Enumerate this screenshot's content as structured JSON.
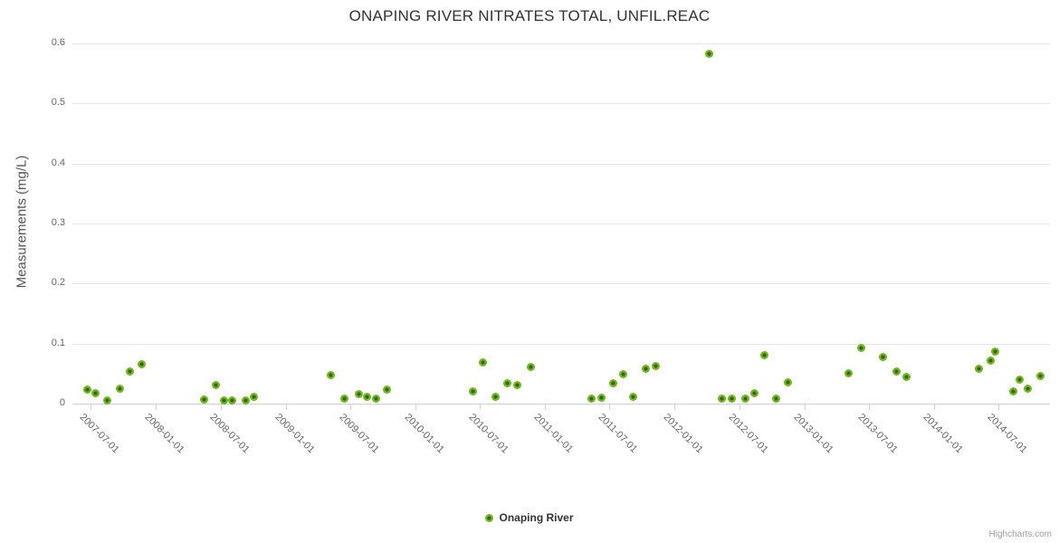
{
  "credits": "Highcharts.com",
  "colors": {
    "grid": "#e6e6e6",
    "axis_line": "#ccd1dd",
    "title_text": "#333333",
    "axis_text": "#666666",
    "legend_text": "#333333",
    "credits_text": "#9a9fa8",
    "marker_outer": "#72b71e",
    "marker_inner": "#2e6600"
  },
  "chart_data": {
    "type": "scatter",
    "title": "ONAPING RIVER NITRATES TOTAL, UNFIL.REAC",
    "xlabel": "",
    "ylabel": "Measurements (mg/L)",
    "ylim": [
      0,
      0.6
    ],
    "xlim": [
      "2007-05-11",
      "2014-11-23"
    ],
    "grid": "horizontal",
    "legend_position": "bottom-center",
    "y_tick_values": [
      0,
      0.1,
      0.2,
      0.3,
      0.4,
      0.5,
      0.6
    ],
    "y_tick_labels": [
      "0",
      "0.1",
      "0.2",
      "0.3",
      "0.4",
      "0.5",
      "0.6"
    ],
    "x_tick_labels": [
      "2007-07-01",
      "2008-01-01",
      "2008-07-01",
      "2009-01-01",
      "2009-07-01",
      "2010-01-01",
      "2010-07-01",
      "2011-01-01",
      "2011-07-01",
      "2012-01-01",
      "2012-07-01",
      "2013-01-01",
      "2013-07-01",
      "2014-01-01",
      "2014-07-01"
    ],
    "series": [
      {
        "name": "Onaping River",
        "color": "#72b71e",
        "marker_inner_color": "#2e6600",
        "points": [
          [
            "2007-06-21",
            0.023
          ],
          [
            "2007-07-14",
            0.018
          ],
          [
            "2007-08-18",
            0.006
          ],
          [
            "2007-09-21",
            0.025
          ],
          [
            "2007-10-19",
            0.054
          ],
          [
            "2007-11-21",
            0.066
          ],
          [
            "2008-05-15",
            0.007
          ],
          [
            "2008-06-17",
            0.031
          ],
          [
            "2008-07-12",
            0.005
          ],
          [
            "2008-08-04",
            0.005
          ],
          [
            "2008-09-11",
            0.005
          ],
          [
            "2008-10-04",
            0.012
          ],
          [
            "2009-05-09",
            0.048
          ],
          [
            "2009-06-14",
            0.009
          ],
          [
            "2009-07-27",
            0.016
          ],
          [
            "2009-08-17",
            0.011
          ],
          [
            "2009-09-11",
            0.008
          ],
          [
            "2009-10-12",
            0.023
          ],
          [
            "2010-06-11",
            0.021
          ],
          [
            "2010-07-09",
            0.069
          ],
          [
            "2010-08-14",
            0.012
          ],
          [
            "2010-09-16",
            0.034
          ],
          [
            "2010-10-14",
            0.031
          ],
          [
            "2010-11-21",
            0.061
          ],
          [
            "2011-05-11",
            0.009
          ],
          [
            "2011-06-08",
            0.01
          ],
          [
            "2011-07-13",
            0.034
          ],
          [
            "2011-08-10",
            0.049
          ],
          [
            "2011-09-05",
            0.011
          ],
          [
            "2011-10-11",
            0.058
          ],
          [
            "2011-11-10",
            0.063
          ],
          [
            "2012-04-06",
            0.583
          ],
          [
            "2012-05-14",
            0.009
          ],
          [
            "2012-06-11",
            0.009
          ],
          [
            "2012-07-17",
            0.009
          ],
          [
            "2012-08-12",
            0.017
          ],
          [
            "2012-09-09",
            0.08
          ],
          [
            "2012-10-12",
            0.008
          ],
          [
            "2012-11-14",
            0.036
          ],
          [
            "2013-05-06",
            0.051
          ],
          [
            "2013-06-09",
            0.093
          ],
          [
            "2013-08-09",
            0.077
          ],
          [
            "2013-09-16",
            0.054
          ],
          [
            "2013-10-14",
            0.045
          ],
          [
            "2014-05-06",
            0.058
          ],
          [
            "2014-06-08",
            0.072
          ],
          [
            "2014-06-21",
            0.086
          ],
          [
            "2014-08-11",
            0.02
          ],
          [
            "2014-08-29",
            0.04
          ],
          [
            "2014-09-21",
            0.025
          ],
          [
            "2014-10-27",
            0.046
          ]
        ]
      }
    ]
  }
}
